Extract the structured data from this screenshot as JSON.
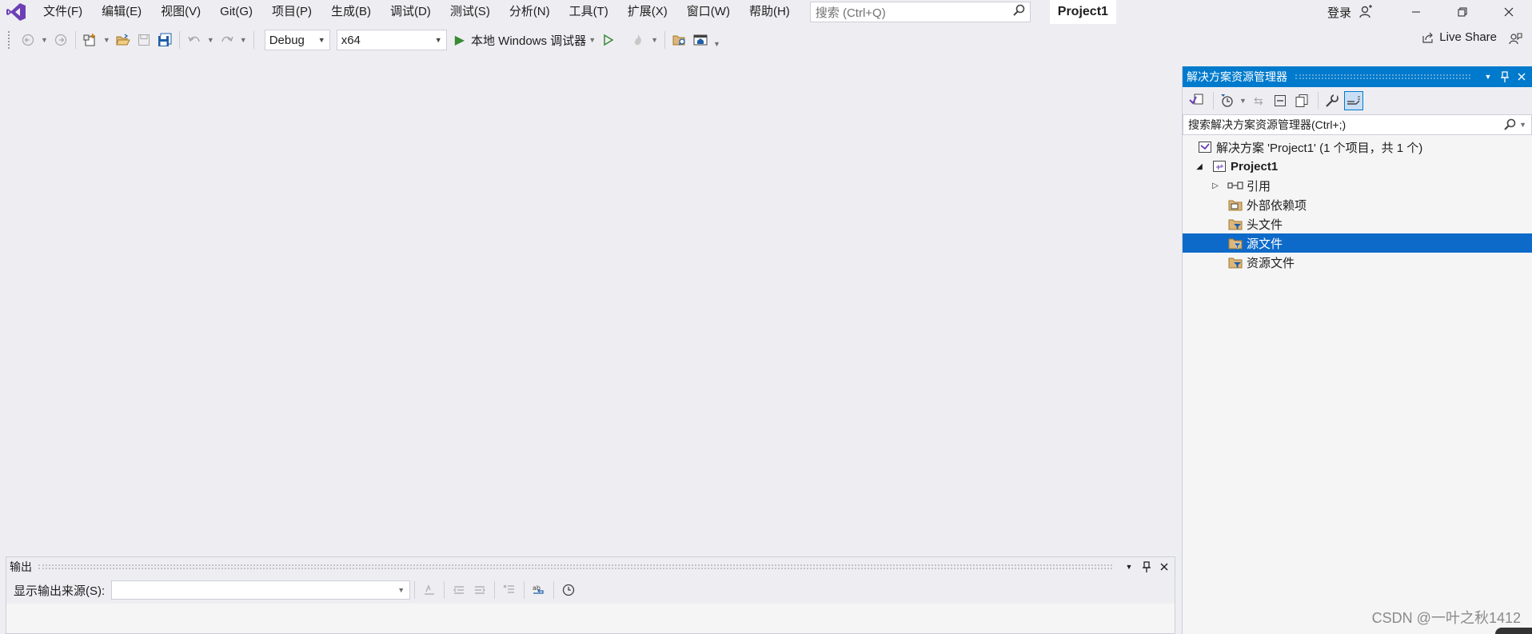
{
  "app": {
    "menu": [
      "文件(F)",
      "编辑(E)",
      "视图(V)",
      "Git(G)",
      "项目(P)",
      "生成(B)",
      "调试(D)",
      "测试(S)",
      "分析(N)",
      "工具(T)",
      "扩展(X)",
      "窗口(W)",
      "帮助(H)"
    ],
    "search_placeholder": "搜索 (Ctrl+Q)",
    "project_title": "Project1",
    "login_label": "登录",
    "accent_color": "#007acc"
  },
  "toolbar": {
    "config": "Debug",
    "platform": "x64",
    "debugger_label": "本地 Windows 调试器",
    "liveshare_label": "Live Share"
  },
  "output": {
    "title": "输出",
    "source_label": "显示输出来源(S):",
    "source_value": ""
  },
  "solution_explorer": {
    "title": "解决方案资源管理器",
    "search_placeholder": "搜索解决方案资源管理器(Ctrl+;)",
    "solution_label": "解决方案 'Project1' (1 个项目，共 1 个)",
    "project_label": "Project1",
    "items": [
      {
        "label": "引用",
        "icon": "references-icon",
        "expandable": true
      },
      {
        "label": "外部依赖项",
        "icon": "external-deps-icon",
        "expandable": false
      },
      {
        "label": "头文件",
        "icon": "filter-folder-icon",
        "expandable": false
      },
      {
        "label": "源文件",
        "icon": "filter-folder-icon",
        "expandable": false,
        "selected": true
      },
      {
        "label": "资源文件",
        "icon": "filter-folder-icon",
        "expandable": false
      }
    ]
  },
  "watermark": "CSDN @一叶之秋1412"
}
